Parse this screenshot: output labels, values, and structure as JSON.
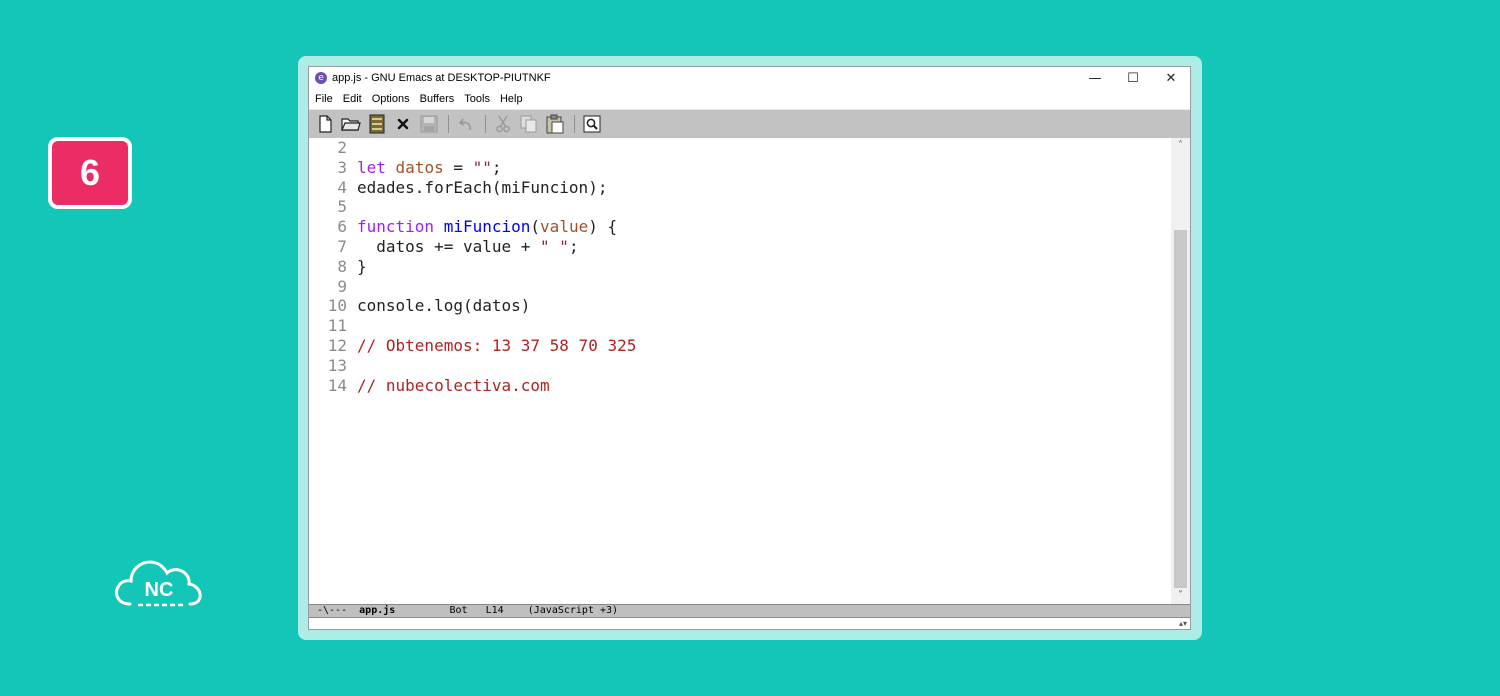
{
  "badge": {
    "number": "6"
  },
  "logo": {
    "text": "NC"
  },
  "window": {
    "title": "app.js - GNU Emacs at DESKTOP-PIUTNKF",
    "controls": {
      "minimize": "—",
      "maximize": "☐",
      "close": "✕"
    }
  },
  "menubar": {
    "items": [
      "File",
      "Edit",
      "Options",
      "Buffers",
      "Tools",
      "Help"
    ]
  },
  "toolbar": {
    "buttons": [
      "new-file",
      "open-folder",
      "dired",
      "close-buffer",
      "save",
      "undo",
      "cut",
      "copy",
      "paste",
      "search"
    ]
  },
  "editor": {
    "lines": [
      {
        "n": "2",
        "tokens": []
      },
      {
        "n": "3",
        "tokens": [
          {
            "t": "let",
            "c": "kw"
          },
          {
            "t": " "
          },
          {
            "t": "datos",
            "c": "var"
          },
          {
            "t": " = "
          },
          {
            "t": "\"\"",
            "c": "str"
          },
          {
            "t": ";"
          }
        ]
      },
      {
        "n": "4",
        "tokens": [
          {
            "t": "edades.forEach(miFuncion);"
          }
        ]
      },
      {
        "n": "5",
        "tokens": []
      },
      {
        "n": "6",
        "tokens": [
          {
            "t": "function",
            "c": "kw"
          },
          {
            "t": " "
          },
          {
            "t": "miFuncion",
            "c": "fn"
          },
          {
            "t": "("
          },
          {
            "t": "value",
            "c": "var"
          },
          {
            "t": ") {"
          }
        ]
      },
      {
        "n": "7",
        "tokens": [
          {
            "t": "  datos += value + "
          },
          {
            "t": "\" \"",
            "c": "str"
          },
          {
            "t": ";"
          }
        ]
      },
      {
        "n": "8",
        "tokens": [
          {
            "t": "}"
          }
        ]
      },
      {
        "n": "9",
        "tokens": []
      },
      {
        "n": "10",
        "tokens": [
          {
            "t": "console.log(datos)"
          }
        ]
      },
      {
        "n": "11",
        "tokens": []
      },
      {
        "n": "12",
        "tokens": [
          {
            "t": "// Obtenemos: 13 37 58 70 325",
            "c": "cmt"
          }
        ]
      },
      {
        "n": "13",
        "tokens": []
      },
      {
        "n": "14",
        "tokens": [
          {
            "t": "// nubecolectiva.com",
            "c": "cmt"
          }
        ]
      }
    ]
  },
  "modeline": {
    "status": "-\\---",
    "buffer": "app.js",
    "position": "Bot",
    "line": "L14",
    "mode": "(JavaScript +3)"
  }
}
